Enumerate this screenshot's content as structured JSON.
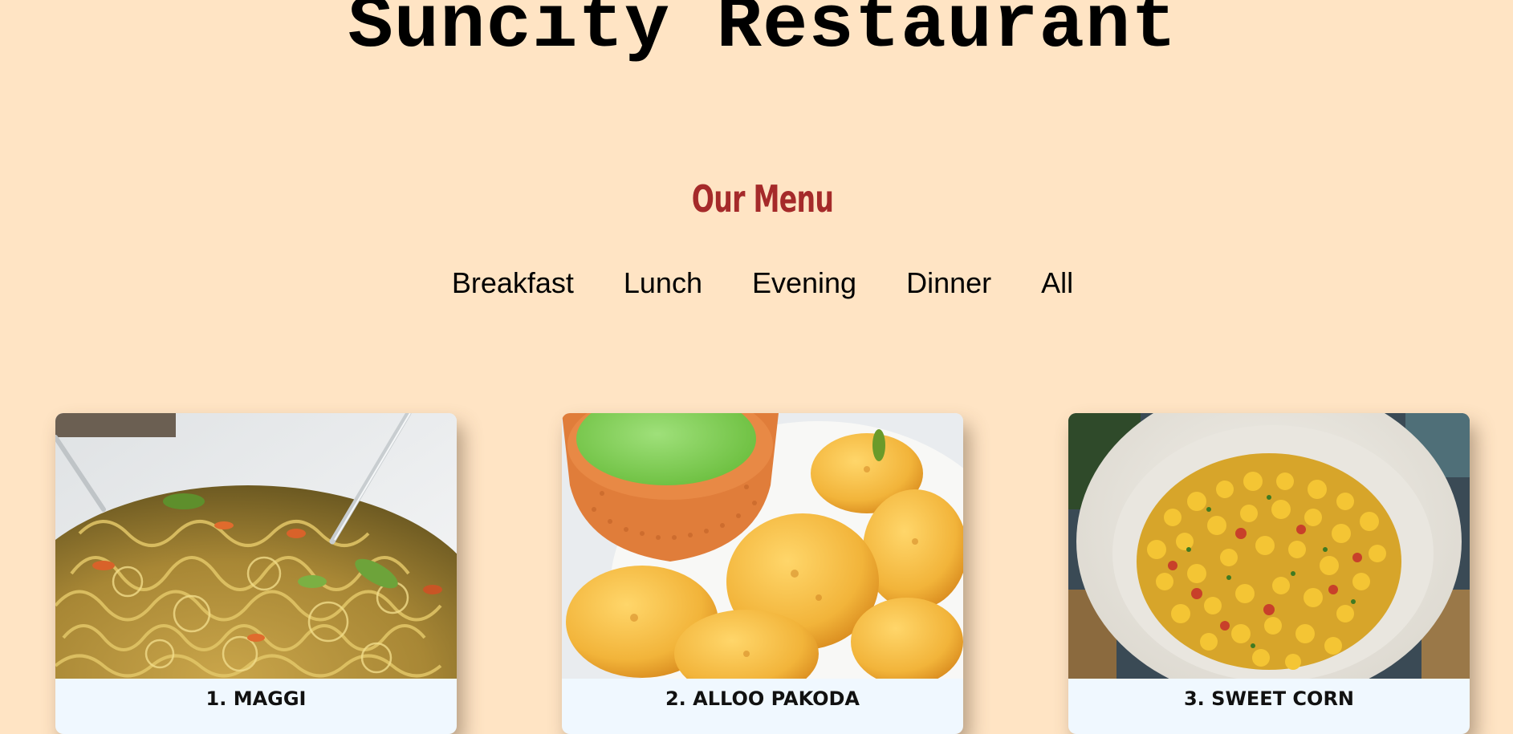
{
  "header": {
    "site_title": "Suncity Restaurant"
  },
  "menu": {
    "heading": "Our Menu",
    "heading_color": "#a52a2a",
    "filters": [
      "Breakfast",
      "Lunch",
      "Evening",
      "Dinner",
      "All"
    ]
  },
  "items": [
    {
      "title": "1. MAGGI",
      "image_icon": "noodles-photo"
    },
    {
      "title": "2. ALLOO PAKODA",
      "image_icon": "pakoda-with-chutney-photo"
    },
    {
      "title": "3. SWEET CORN",
      "image_icon": "corn-salad-bowl-photo"
    }
  ],
  "colors": {
    "page_background": "#ffe4c4",
    "card_caption_background": "#f0f8ff"
  }
}
